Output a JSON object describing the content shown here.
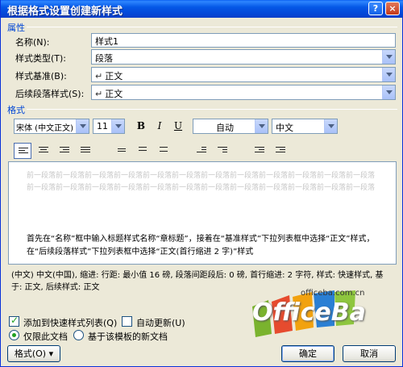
{
  "window": {
    "title": "根据格式设置创建新样式",
    "help_label": "?",
    "close_label": "×"
  },
  "properties": {
    "section_label": "属性",
    "name_label": "名称(N):",
    "name_value": "样式1",
    "type_label": "样式类型(T):",
    "type_value": "段落",
    "based_label": "样式基准(B):",
    "based_value": "正文",
    "following_label": "后续段落样式(S):",
    "following_value": "正文",
    "para_mark": "↵"
  },
  "format": {
    "section_label": "格式",
    "font": "宋体 (中文正文)",
    "size": "11",
    "bold": "B",
    "italic": "I",
    "underline": "U",
    "color": "自动",
    "language": "中文"
  },
  "preview": {
    "gray_text": "前一段落前一段落前一段落前一段落前一段落前一段落前一段落前一段落前一段落前一段落前一段落前一段落前一段落前一段落前一段落前一段落前一段落前一段落前一段落前一段落前一段落前一段落前一段落前一段落",
    "main_text": "首先在“名称”框中输入标题样式名称“章标题”，接着在“基准样式”下拉列表框中选择“正文”样式，在“后续段落样式”下拉列表框中选择“正文(首行缩进 2 字)”样式"
  },
  "description": "(中文) 中文(中国), 缩进: 行距: 最小值 16 磅, 段落间距段后: 0 磅, 首行缩进: 2 字符, 样式: 快速样式, 基于: 正文, 后续样式: 正文",
  "watermark": {
    "url": "officeba.com.cn",
    "brand": "OfficeBa"
  },
  "options": {
    "add_quick_label": "添加到快速样式列表(Q)",
    "auto_update_label": "自动更新(U)",
    "only_doc_label": "仅限此文档",
    "template_label": "基于该模板的新文档"
  },
  "buttons": {
    "format_label": "格式(O) ▾",
    "ok_label": "确定",
    "cancel_label": "取消"
  },
  "colors": {
    "title_bar": "#0558e6",
    "section_text": "#0046d5"
  }
}
